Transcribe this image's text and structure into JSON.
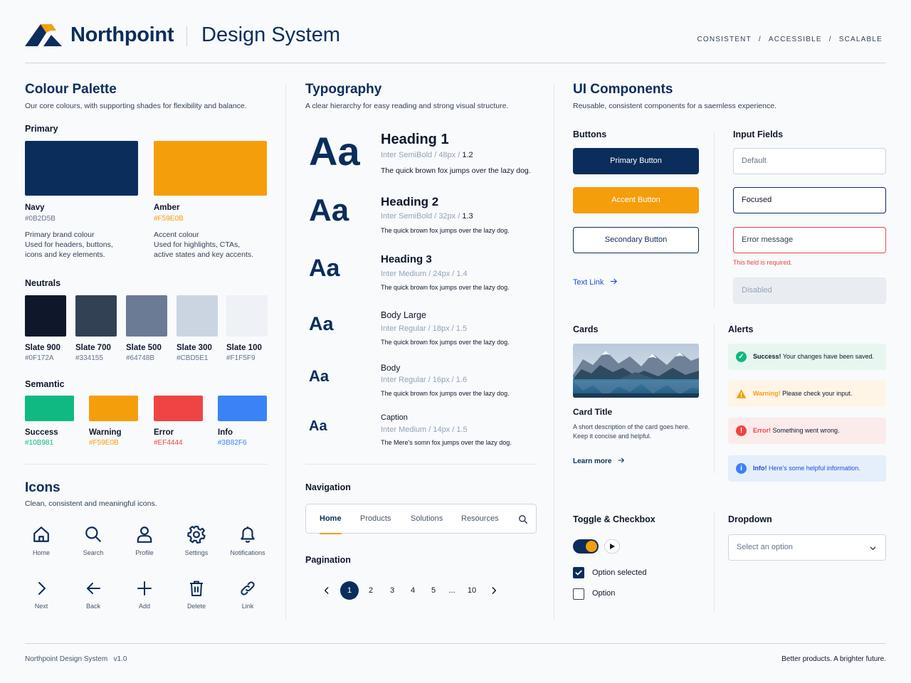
{
  "header": {
    "brand": "Northpoint",
    "subtitle": "Design System",
    "tagline": [
      "CONSISTENT",
      "ACCESSIBLE",
      "SCALABLE"
    ],
    "separator": "/"
  },
  "palette": {
    "title": "Colour Palette",
    "desc": "Our core colours, with supporting shades for flexibility and balance.",
    "primary_title": "Primary",
    "primary": [
      {
        "name": "Navy",
        "hex": "#0B2D5B",
        "color": "#0B2D5B",
        "lines": [
          "Primary brand colour",
          "Used for headers, buttons,",
          "icons and key elements."
        ]
      },
      {
        "name": "Amber",
        "hex": "#F59E0B",
        "color": "#F59E0B",
        "lines": [
          "Accent colour",
          "Used for highlights, CTAs,",
          "active states and key accents."
        ]
      }
    ],
    "neutrals_title": "Neutrals",
    "neutrals": [
      {
        "name": "Slate 900",
        "hex": "#0F172A",
        "color": "#0F172A"
      },
      {
        "name": "Slate 700",
        "hex": "#334155",
        "color": "#334155"
      },
      {
        "name": "Slate 500",
        "hex": "#64748B",
        "color": "#64748B"
      },
      {
        "name": "Slate 300",
        "hex": "#CBD5E1",
        "color": "#CBD5E1"
      },
      {
        "name": "Slate 100",
        "hex": "#F1F5F9",
        "color": "#F1F5F9"
      }
    ],
    "semantic_title": "Semantic",
    "semantic": [
      {
        "name": "Success",
        "hex": "#10B981",
        "color": "#10B981"
      },
      {
        "name": "Warning",
        "hex": "#F59E0B",
        "color": "#F59E0B"
      },
      {
        "name": "Error",
        "hex": "#EF4444",
        "color": "#EF4444"
      },
      {
        "name": "Info",
        "hex": "#3B82F6",
        "color": "#3B82F6"
      }
    ]
  },
  "icons": {
    "title": "Icons",
    "desc": "Clean, consistent and meaningful icons.",
    "items": [
      "Home",
      "Search",
      "Profile",
      "Settings",
      "Notifications",
      "Next",
      "Back",
      "Add",
      "Delete",
      "Link"
    ]
  },
  "typography": {
    "title": "Typography",
    "desc": "A clear hierarchy for easy reading and strong visual structure.",
    "sample": "Aa",
    "styles": [
      {
        "name": "Heading 1",
        "spec_a": "Inter SemiBold / 48px / ",
        "spec_b": "1.2",
        "sample": "The quick brown fox jumps over the lazy dog."
      },
      {
        "name": "Heading 2",
        "spec_a": "Inter SemiBold / 32px / ",
        "spec_b": "1.3",
        "sample": "The quick brown fox jumps over the lazy dog."
      },
      {
        "name": "Heading 3",
        "spec_a": "Inter Medium / 24px / 1.4",
        "spec_b": "",
        "sample": "The quick brown fox jumps over the lazy dog."
      },
      {
        "name": "Body Large",
        "spec_a": "Inter Regular / 18px / 1.5",
        "spec_b": "",
        "sample": "The quick brown fox jumps over the lazy dog."
      },
      {
        "name": "Body",
        "spec_a": "Inter Regular / 16px / 1.6",
        "spec_b": "",
        "sample": "The quick brown fox jumps over the lazy dog."
      },
      {
        "name": "Caption",
        "spec_a": "Inter Medium / 14px / 1.5",
        "spec_b": "",
        "sample": "The Mere's somn fox jumps over the lazy dog."
      }
    ]
  },
  "navigation": {
    "title": "Navigation",
    "items": [
      "Home",
      "Products",
      "Solutions",
      "Resources"
    ],
    "active_index": 0
  },
  "pagination": {
    "title": "Pagination",
    "pages": [
      "1",
      "2",
      "3",
      "4",
      "5",
      "...",
      "10"
    ],
    "active": "1"
  },
  "components": {
    "title": "UI Components",
    "desc": "Reusable, consistent components for a saemless experience.",
    "buttons_title": "Buttons",
    "primary_button": "Primary Button",
    "accent_button": "Accent Button",
    "secondary_button": "Secondary Button",
    "text_link": "Text Link",
    "inputs_title": "Input Fields",
    "input_default": "Default",
    "input_focused": "Focused",
    "input_error": "Error message",
    "input_error_hint": "This field is required.",
    "input_disabled": "Disabled",
    "cards_title": "Cards",
    "card_title": "Card Title",
    "card_desc_1": "A short description of the card goes here.",
    "card_desc_2": "Keep it concise and helpful.",
    "card_link": "Learn more",
    "alerts_title": "Alerts",
    "alerts": [
      {
        "type": "success",
        "strong": "Success!",
        "text": " Your changes have been saved.",
        "bg": "#E7F6EF",
        "icon_color": "#10B981",
        "strong_color": "#0F172A",
        "text_color": "#0F172A",
        "glyph": "✓"
      },
      {
        "type": "warning",
        "strong": "Warning!",
        "text": " Please check your input.",
        "bg": "#FEF5E7",
        "icon_color": "#F59E0B",
        "strong_color": "#F59E0B",
        "text_color": "#0F172A",
        "glyph": "!"
      },
      {
        "type": "error",
        "strong": "Error!",
        "text": " Something went wrong.",
        "bg": "#FCEBEB",
        "icon_color": "#EF4444",
        "strong_color": "#EF4444",
        "text_color": "#0F172A",
        "glyph": "!"
      },
      {
        "type": "info",
        "strong": "Info!",
        "text": " Here's some helpful information.",
        "bg": "#E5EEFB",
        "icon_color": "#3B82F6",
        "strong_color": "#1D4ED8",
        "text_color": "#1D4ED8",
        "glyph": "i"
      }
    ],
    "toggle_title": "Toggle & Checkbox",
    "checkbox_checked": "Option selected",
    "checkbox_unchecked": "Option",
    "dropdown_title": "Dropdown",
    "dropdown_placeholder": "Select an option"
  },
  "footer": {
    "left": "Northpoint Design System   v1.0",
    "right": "Better products. A brighter future."
  }
}
